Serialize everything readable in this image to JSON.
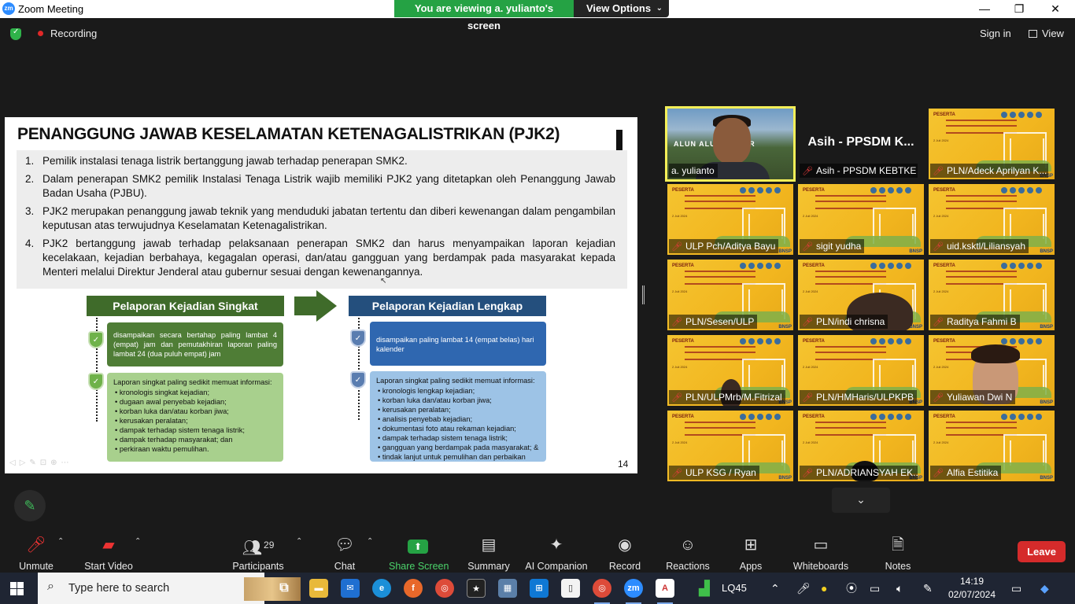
{
  "window": {
    "title": "Zoom Meeting",
    "banner_message": "You are viewing a. yulianto's screen",
    "view_options": "View Options"
  },
  "topbar": {
    "recording": "Recording",
    "sign_in": "Sign in",
    "view": "View"
  },
  "slide": {
    "heading": "PENANGGUNG JAWAB KESELAMATAN KETENAGALISTRIKAN (PJK2)",
    "items": [
      {
        "num": "1.",
        "text": "Pemilik instalasi tenaga listrik bertanggung jawab terhadap penerapan SMK2."
      },
      {
        "num": "2.",
        "text": "Dalam penerapan SMK2 pemilik Instalasi Tenaga Listrik wajib memiliki PJK2 yang ditetapkan oleh Penanggung Jawab Badan Usaha (PJBU)."
      },
      {
        "num": "3.",
        "text": "PJK2 merupakan penanggung jawab teknik yang menduduki jabatan tertentu dan diberi kewenangan dalam pengambilan keputusan atas terwujudnya Keselamatan Ketenagalistrikan."
      },
      {
        "num": "4.",
        "text": "PJK2 bertanggung jawab terhadap pelaksanaan penerapan SMK2 dan harus menyampaikan laporan kejadian kecelakaan, kejadian berbahaya, kegagalan operasi, dan/atau gangguan yang berdampak pada masyarakat kepada Menteri melalui Direktur Jenderal atau gubernur sesuai dengan kewenangannya."
      }
    ],
    "left_header": "Pelaporan Kejadian Singkat",
    "right_header": "Pelaporan Kejadian Lengkap",
    "left_box1": "disampaikan secara bertahap paling lambat 4 (empat) jam dan pemutakhiran laporan paling lambat 24 (dua puluh empat) jam",
    "left_box2_title": "Laporan singkat paling sedikit memuat informasi:",
    "left_box2_items": [
      "kronologis singkat kejadian;",
      "dugaan awal penyebab kejadian;",
      "korban luka dan/atau korban jiwa;",
      "kerusakan peralatan;",
      "dampak terhadap sistem tenaga listrik;",
      "dampak terhadap masyarakat; dan",
      "perkiraan waktu pemulihan."
    ],
    "right_box1": "disampaikan paling lambat 14 (empat belas) hari kalender",
    "right_box2_title": "Laporan singkat paling sedikit memuat informasi:",
    "right_box2_items": [
      "kronologis lengkap kejadian;",
      "korban luka dan/atau korban jiwa;",
      "kerusakan peralatan;",
      "analisis penyebab kejadian;",
      "dokumentasi foto atau rekaman kejadian;",
      "dampak terhadap sistem tenaga listrik;",
      "gangguan yang berdampak pada masyarakat; &",
      "tindak lanjut untuk pemulihan dan perbaikan"
    ],
    "page_number": "14"
  },
  "gallery": {
    "speaker": "a. yulianto",
    "speaker_sign": "ALUN ALUN BOGOR",
    "asih_big": "Asih - PPSDM K...",
    "tiles": [
      {
        "name": "Asih - PPSDM KEBTKE"
      },
      {
        "name": "PLN/Adeck Aprilyan K..."
      },
      {
        "name": "ULP Pch/Aditya Bayu"
      },
      {
        "name": "sigit yudha"
      },
      {
        "name": "uid.ksktl/Liliansyah"
      },
      {
        "name": "PLN/Sesen/ULP"
      },
      {
        "name": "PLN/indi chrisna"
      },
      {
        "name": "Raditya Fahmi B"
      },
      {
        "name": "PLN/ULPMrb/M.Fitrizal"
      },
      {
        "name": "PLN/HMHaris/ULPKPB"
      },
      {
        "name": "Yuliawan Dwi N"
      },
      {
        "name": "ULP KSG / Ryan"
      },
      {
        "name": "PLN/ADRIANSYAH EK..."
      },
      {
        "name": "Alfia Estitika"
      }
    ],
    "slide_label": "PESERTA",
    "slide_date": "2 Juli 2024",
    "bnsp": "BNSP"
  },
  "toolbar": {
    "unmute": "Unmute",
    "start_video": "Start Video",
    "participants": "Participants",
    "participants_count": "29",
    "chat": "Chat",
    "share_screen": "Share Screen",
    "summary": "Summary",
    "ai_companion": "AI Companion",
    "record": "Record",
    "reactions": "Reactions",
    "apps": "Apps",
    "whiteboards": "Whiteboards",
    "notes": "Notes",
    "leave": "Leave"
  },
  "taskbar": {
    "search_placeholder": "Type here to search",
    "stock": "LQ45",
    "time": "14:19",
    "date": "02/07/2024"
  }
}
